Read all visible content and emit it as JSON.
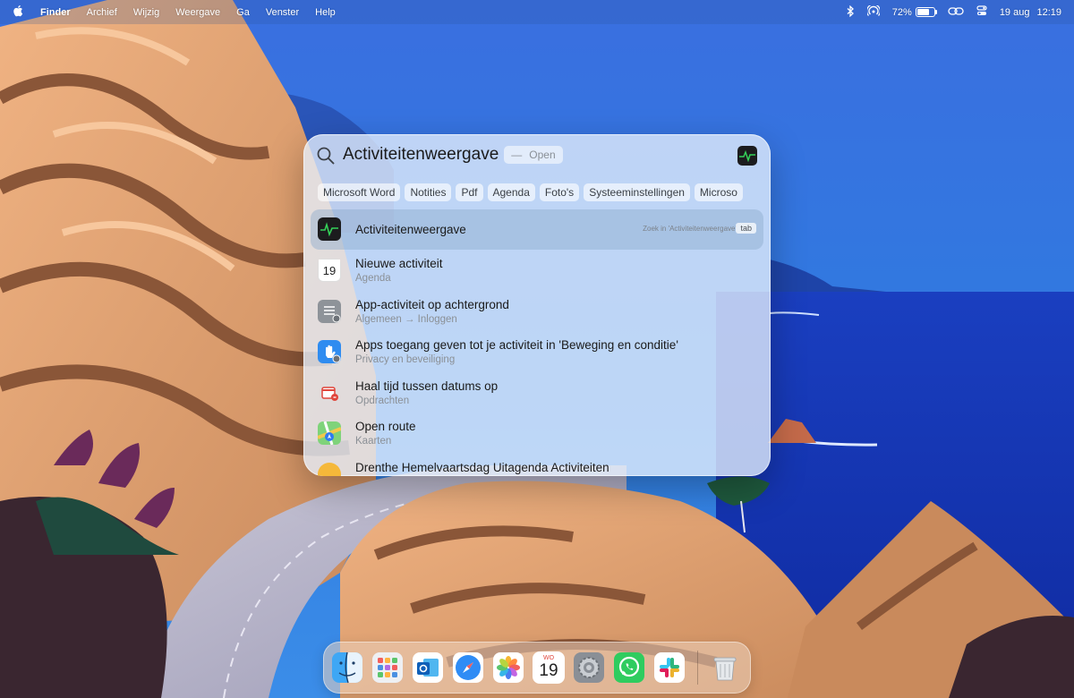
{
  "menubar": {
    "app_name": "Finder",
    "menus": [
      "Archief",
      "Wijzig",
      "Weergave",
      "Ga",
      "Venster",
      "Help"
    ],
    "status_icons": [
      "bluetooth-icon",
      "airdrop-icon",
      "battery-icon",
      "screen-mirroring-icon",
      "control-center-icon"
    ],
    "battery_percent": "72%",
    "battery_level": 0.72,
    "date": "19 aug",
    "time": "12:19"
  },
  "spotlight": {
    "query": "Activiteitenweergave",
    "hint_dash": "—",
    "hint_action": "Open",
    "filters": [
      "Microsoft Word",
      "Notities",
      "Pdf",
      "Agenda",
      "Foto's",
      "Systeeminstellingen",
      "Microso"
    ],
    "top_hit": {
      "title": "Activiteitenweergave",
      "search_in": "Zoek in 'Activiteitenweergave'",
      "tab_label": "tab",
      "icon": "activity-monitor-icon"
    },
    "results": [
      {
        "title": "Nieuwe activiteit",
        "subtitle": "Agenda",
        "icon": "calendar-icon",
        "calendar_day": "19"
      },
      {
        "title": "App-activiteit op achtergrond",
        "subtitle": "Algemeen → Inloggen",
        "icon": "settings-list-icon"
      },
      {
        "title": "Apps toegang geven tot je activiteit in 'Beweging en conditie'",
        "subtitle": "Privacy en beveiliging",
        "icon": "privacy-hand-icon"
      },
      {
        "title": "Haal tijd tussen datums op",
        "subtitle": "Opdrachten",
        "icon": "shortcuts-calendar-icon"
      },
      {
        "title": "Open route",
        "subtitle": "Kaarten",
        "icon": "maps-icon"
      },
      {
        "title": "Drenthe Hemelvaartsdag Uitagenda Activiteiten",
        "subtitle": "",
        "icon": "web-result-icon"
      }
    ]
  },
  "dock": {
    "apps": [
      "finder-icon",
      "launchpad-icon",
      "outlook-icon",
      "safari-icon",
      "photos-icon",
      "calendar-icon",
      "system-settings-icon",
      "whatsapp-icon",
      "slack-icon"
    ],
    "calendar_month": "WO",
    "calendar_day": "19",
    "trash": "trash-icon"
  },
  "colors": {
    "sky": "#2d6fd8",
    "sea": "#1540c9",
    "cliff": "#e4a26f",
    "selected_row": "#8caacd"
  }
}
